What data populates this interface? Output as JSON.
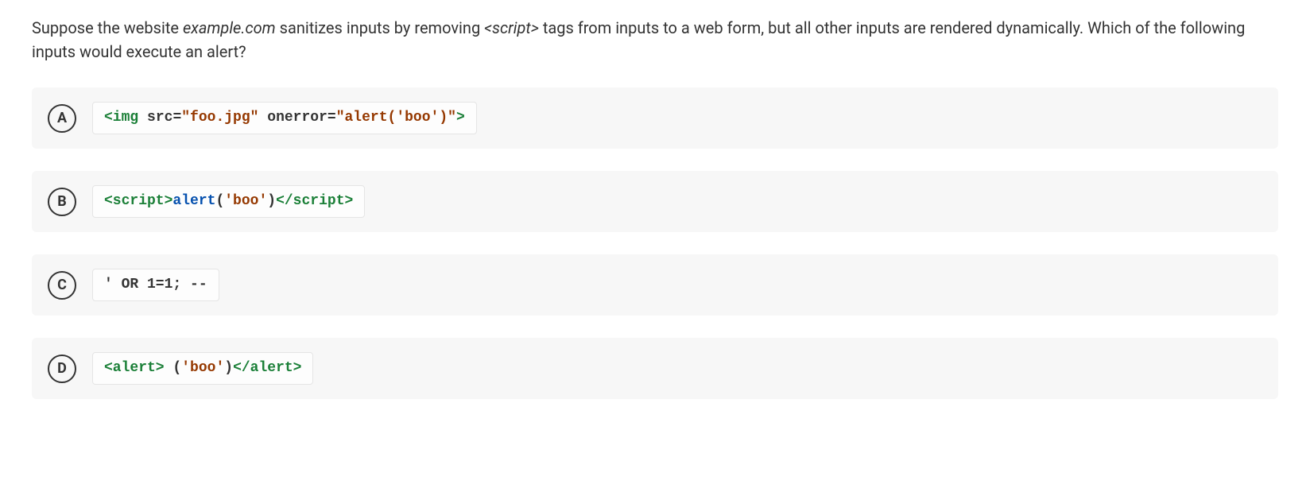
{
  "question": {
    "pre": "Suppose the website ",
    "em": "example.com",
    "mid": " sanitizes inputs by removing ",
    "tag": "<script>",
    "post": " tags from inputs to a web form, but all other inputs are rendered dynamically. Which of the following inputs would execute an alert?"
  },
  "options": [
    {
      "letter": "A",
      "tokens": {
        "t0": "<img",
        "t1": " src",
        "t2": "=",
        "t3": "\"foo.jpg\"",
        "t4": " onerror",
        "t5": "=",
        "t6": "\"alert('boo')\"",
        "t7": ">"
      }
    },
    {
      "letter": "B",
      "tokens": {
        "t0": "<script>",
        "t1": "alert",
        "t2": "(",
        "t3": "'boo'",
        "t4": ")",
        "t5": "</script>"
      }
    },
    {
      "letter": "C",
      "tokens": {
        "t0": "' OR 1=1; --"
      }
    },
    {
      "letter": "D",
      "tokens": {
        "t0": "<alert>",
        "t1": " (",
        "t2": "'boo'",
        "t3": ")",
        "t4": "</alert>"
      }
    }
  ]
}
